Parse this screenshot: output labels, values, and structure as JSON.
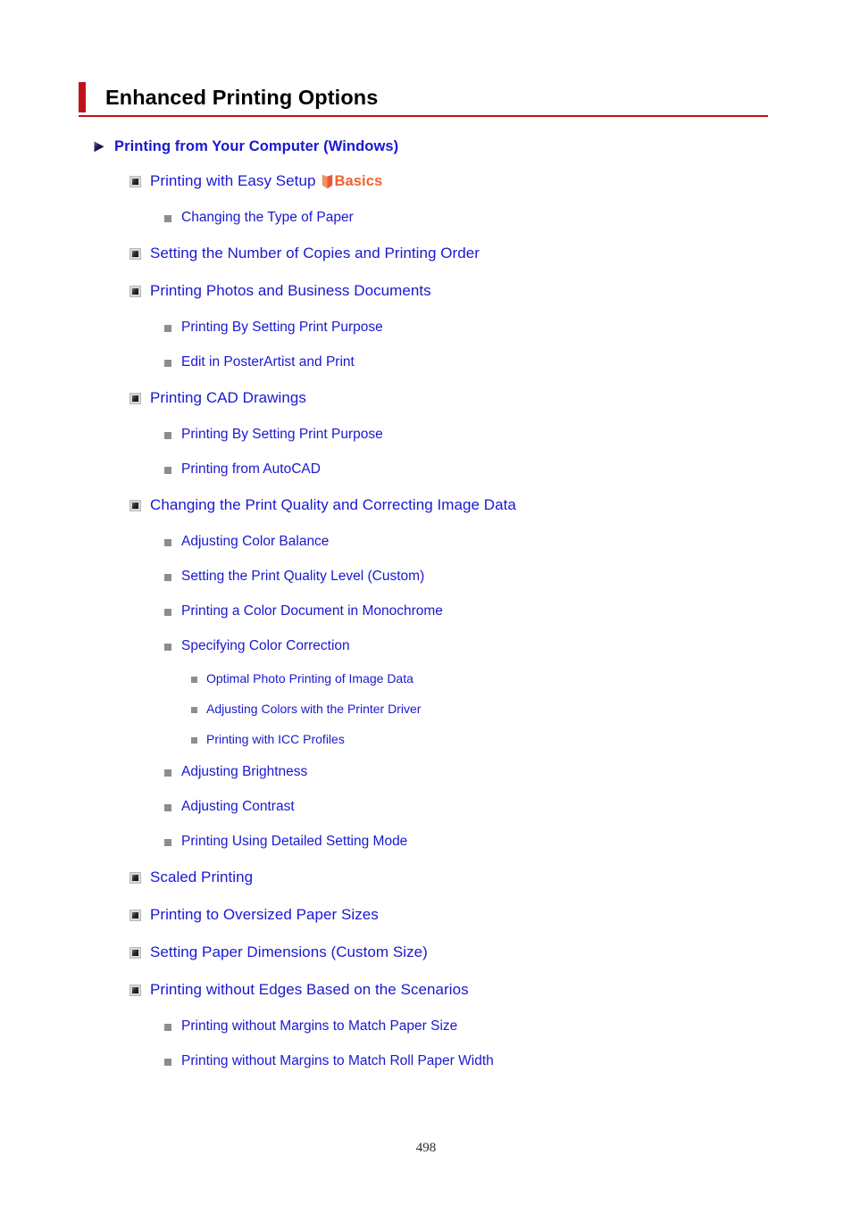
{
  "document": {
    "title": "Enhanced Printing Options",
    "page_number": "498",
    "accent_color": "#c1121b",
    "link_color": "#1a18d0",
    "basics_color": "#f4612f"
  },
  "badges": {
    "basics_label": "Basics"
  },
  "toc": {
    "section": {
      "label": "Printing from Your Computer (Windows)"
    },
    "items": [
      {
        "level": 2,
        "label": "Printing with Easy Setup",
        "badge": "Basics"
      },
      {
        "level": 3,
        "label": "Changing the Type of Paper"
      },
      {
        "level": 2,
        "label": "Setting the Number of Copies and Printing Order"
      },
      {
        "level": 2,
        "label": "Printing Photos and Business Documents"
      },
      {
        "level": 3,
        "label": "Printing By Setting Print Purpose"
      },
      {
        "level": 3,
        "label": "Edit in PosterArtist and Print"
      },
      {
        "level": 2,
        "label": "Printing CAD Drawings"
      },
      {
        "level": 3,
        "label": "Printing By Setting Print Purpose"
      },
      {
        "level": 3,
        "label": "Printing from AutoCAD"
      },
      {
        "level": 2,
        "label": "Changing the Print Quality and Correcting Image Data"
      },
      {
        "level": 3,
        "label": "Adjusting Color Balance"
      },
      {
        "level": 3,
        "label": "Setting the Print Quality Level (Custom)"
      },
      {
        "level": 3,
        "label": "Printing a Color Document in Monochrome"
      },
      {
        "level": 3,
        "label": "Specifying Color Correction"
      },
      {
        "level": 4,
        "label": "Optimal Photo Printing of Image Data"
      },
      {
        "level": 4,
        "label": "Adjusting Colors with the Printer Driver"
      },
      {
        "level": 4,
        "label": "Printing with ICC Profiles"
      },
      {
        "level": 3,
        "label": "Adjusting Brightness"
      },
      {
        "level": 3,
        "label": "Adjusting Contrast"
      },
      {
        "level": 3,
        "label": "Printing Using Detailed Setting Mode"
      },
      {
        "level": 2,
        "label": "Scaled Printing"
      },
      {
        "level": 2,
        "label": "Printing to Oversized Paper Sizes"
      },
      {
        "level": 2,
        "label": "Setting Paper Dimensions (Custom Size)"
      },
      {
        "level": 2,
        "label": "Printing without Edges Based on the Scenarios"
      },
      {
        "level": 3,
        "label": "Printing without Margins to Match Paper Size"
      },
      {
        "level": 3,
        "label": "Printing without Margins to Match Roll Paper Width"
      }
    ]
  },
  "icons": {
    "section_bullet": "triangle-right-icon",
    "level2_bullet": "square-3d-icon",
    "level3_bullet": "square-small-icon",
    "level4_bullet": "square-tiny-icon",
    "basics_badge": "book-icon"
  }
}
